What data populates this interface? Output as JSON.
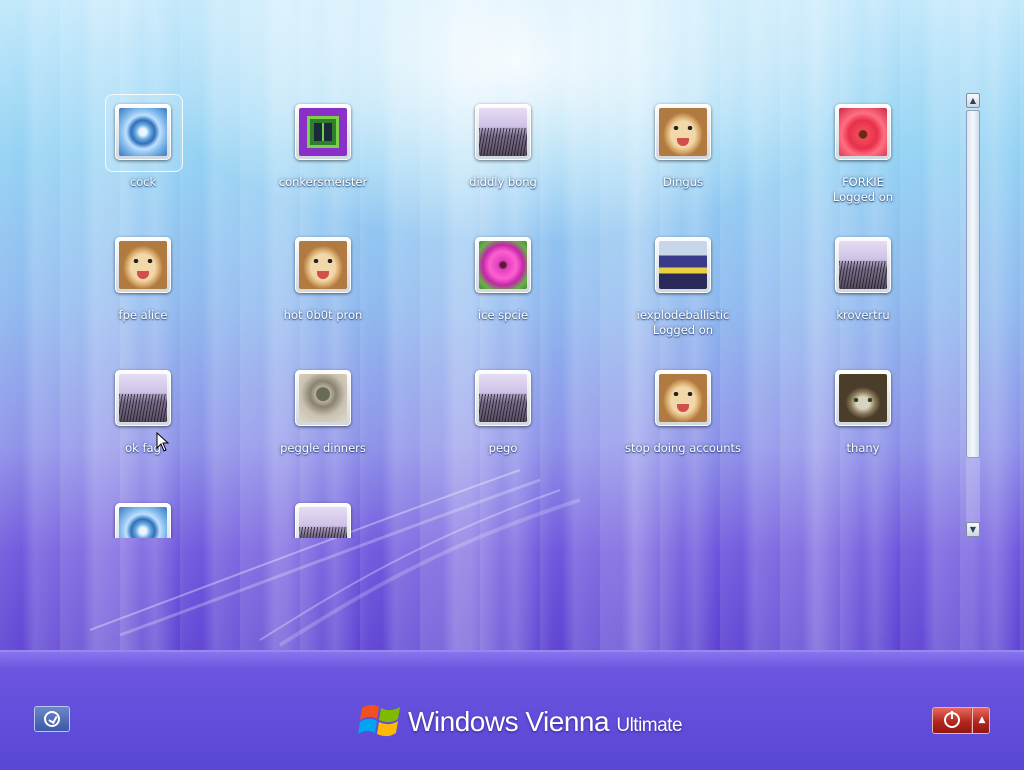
{
  "users": [
    {
      "name": "cock",
      "picture": "blue-flower",
      "selected": true
    },
    {
      "name": "conkersmeister",
      "picture": "chess-board"
    },
    {
      "name": "diddly bong",
      "picture": "grass"
    },
    {
      "name": "Dingus",
      "picture": "dog"
    },
    {
      "name": "FORKIE",
      "status": "Logged on",
      "picture": "red-flower"
    },
    {
      "name": "fpe alice",
      "picture": "dog"
    },
    {
      "name": "hot 0b0t pron",
      "picture": "dog"
    },
    {
      "name": "ice spcie",
      "picture": "pink-flower"
    },
    {
      "name": "iexplodeballistic",
      "status": "Logged on",
      "picture": "train"
    },
    {
      "name": "krovertru",
      "picture": "grass"
    },
    {
      "name": "ok fag",
      "picture": "grass"
    },
    {
      "name": "peggle dinners",
      "picture": "fan"
    },
    {
      "name": "pego",
      "picture": "grass"
    },
    {
      "name": "stop doing accounts",
      "picture": "dog"
    },
    {
      "name": "thany",
      "picture": "cat"
    },
    {
      "name": "",
      "picture": "blue-flower"
    },
    {
      "name": "",
      "picture": "grass"
    }
  ],
  "scrollbar": {
    "up_icon": "scroll-up-arrow-icon",
    "down_icon": "scroll-down-arrow-icon"
  },
  "footer": {
    "ease_of_access_icon": "ease-of-access-icon",
    "brand_windows": "Windows",
    "brand_vienna": "Vienna",
    "brand_edition": "Ultimate",
    "power_icon": "power-icon",
    "power_options_icon": "power-options-arrow-icon"
  },
  "colors": {
    "background_top": "#bfe7fb",
    "background_bottom": "#5a3fd2",
    "power_button": "#b3261d"
  }
}
